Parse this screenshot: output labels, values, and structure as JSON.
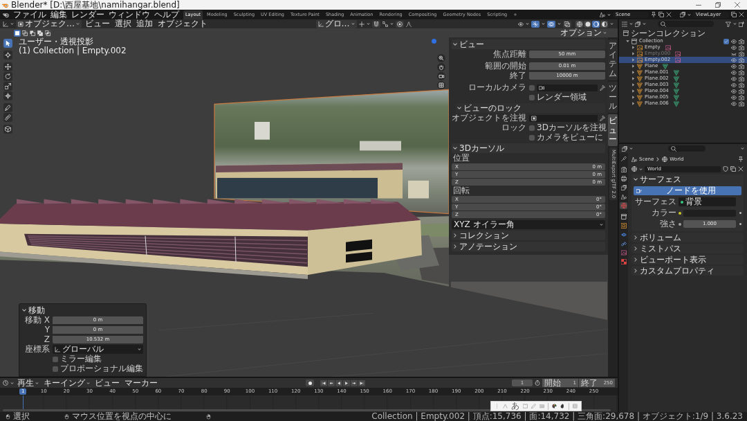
{
  "window": {
    "title": "Blender* [D:\\西屋基地\\namihangar.blend]"
  },
  "top_bar": {
    "menus": [
      "ファイル",
      "編集",
      "レンダー",
      "ウィンドウ",
      "ヘルプ"
    ],
    "workspaces": [
      {
        "label": "Layout",
        "selected": true
      },
      {
        "label": "Modeling",
        "selected": false
      },
      {
        "label": "Sculpting",
        "selected": false
      },
      {
        "label": "UV Editing",
        "selected": false
      },
      {
        "label": "Texture Paint",
        "selected": false
      },
      {
        "label": "Shading",
        "selected": false
      },
      {
        "label": "Animation",
        "selected": false
      },
      {
        "label": "Rendering",
        "selected": false
      },
      {
        "label": "Compositing",
        "selected": false
      },
      {
        "label": "Geometry Nodes",
        "selected": false
      },
      {
        "label": "Scripting",
        "selected": false
      }
    ],
    "add_workspace": "+",
    "scene": "Scene",
    "view_layer": "ViewLayer"
  },
  "viewport": {
    "header": {
      "mode": "オブジェク…",
      "menus": [
        "ビュー",
        "選択",
        "追加",
        "オブジェクト"
      ],
      "orientation": "グロ…",
      "snap": false,
      "proportional": false,
      "gizmos": true,
      "overlays": true,
      "xray": false,
      "shading_modes": [
        {
          "kind": "wireframe",
          "selected": false
        },
        {
          "kind": "solid",
          "selected": false
        },
        {
          "kind": "material",
          "selected": true
        },
        {
          "kind": "rendered",
          "selected": false
        }
      ],
      "select_modes": [
        {
          "kind": "set",
          "selected": true
        },
        {
          "kind": "extend",
          "selected": false
        },
        {
          "kind": "subtract",
          "selected": false
        },
        {
          "kind": "invert",
          "selected": false
        },
        {
          "kind": "intersect",
          "selected": false
        }
      ],
      "options": "オプション"
    },
    "overlay_text": [
      "ユーザー・透視投影",
      "(1) Collection | Empty.002"
    ],
    "tools": [
      {
        "kind": "select",
        "selected": true
      },
      {
        "kind": "cursor",
        "selected": false
      },
      {
        "kind": "move",
        "selected": false
      },
      {
        "kind": "rotate",
        "selected": false
      },
      {
        "kind": "scale",
        "selected": false
      },
      {
        "kind": "transform",
        "selected": false
      },
      {
        "kind": "annotate",
        "selected": false
      },
      {
        "kind": "measure",
        "selected": false
      },
      {
        "kind": "add_cube",
        "selected": false
      }
    ],
    "sidebar": {
      "view": {
        "title": "ビュー",
        "expanded": true,
        "clip": [
          {
            "label": "焦点距離",
            "value": "50 mm"
          },
          {
            "label": "範囲の開始",
            "value": "0.01 m"
          },
          {
            "label": "終了",
            "value": "10000 m"
          }
        ],
        "local_camera": {
          "label": "ローカルカメラ",
          "checked": false
        },
        "render_region": {
          "label": "レンダー領域",
          "checked": false
        },
        "lock": {
          "title": "ビューのロック",
          "expanded": true,
          "lock_object_label": "オブジェクトを注視",
          "lock_label": "ロック",
          "options": [
            {
              "label": "3Dカーソルを注視",
              "checked": false
            },
            {
              "label": "カメラをビューに",
              "checked": false
            }
          ]
        }
      },
      "cursor": {
        "title": "3Dカーソル",
        "expanded": true,
        "location_label": "位置",
        "location": [
          {
            "axis": "X",
            "value": "0 m"
          },
          {
            "axis": "Y",
            "value": "0 m"
          },
          {
            "axis": "Z",
            "value": "0 m"
          }
        ],
        "rotation_label": "回転",
        "rotation": [
          {
            "axis": "X",
            "value": "0°"
          },
          {
            "axis": "Y",
            "value": "0°"
          },
          {
            "axis": "Z",
            "value": "0°"
          }
        ],
        "rotation_mode": "XYZ オイラー角"
      },
      "collapsed": [
        {
          "title": "コレクション",
          "expanded": false
        },
        {
          "title": "アノテーション",
          "expanded": false
        }
      ]
    },
    "sidebar_tabs": [
      {
        "label": "アイテム",
        "kind": "stacked",
        "selected": false
      },
      {
        "label": "ツール",
        "kind": "stacked",
        "selected": false
      },
      {
        "label": "ビュー",
        "kind": "stacked",
        "selected": true
      },
      {
        "label": "MultiExport glTF 2.0",
        "kind": "rotated",
        "selected": false
      }
    ],
    "operator_panel": {
      "title": "移動",
      "expanded": true,
      "fields": [
        {
          "label": "移動 X",
          "value": "0 m"
        },
        {
          "label": "Y",
          "value": "0 m"
        },
        {
          "label": "Z",
          "value": "10.532 m"
        }
      ],
      "orientation_label": "座標系",
      "orientation": "グローバル",
      "options": [
        {
          "label": "ミラー編集",
          "checked": false
        },
        {
          "label": "プロポーショナル編集",
          "checked": false
        }
      ]
    }
  },
  "outliner": {
    "tree": [
      {
        "name": "シーンコレクション",
        "children": [
          {
            "name": "Collection",
            "expanded": true,
            "checked": true,
            "visible": true,
            "children": [
              {
                "name": "Empty",
                "kind": "empty",
                "selected": false,
                "visible": true
              },
              {
                "name": "Empty.000",
                "kind": "empty",
                "selected": false,
                "visible": false
              },
              {
                "name": "Empty.002",
                "kind": "empty",
                "selected": true,
                "visible": true
              },
              {
                "name": "Plane",
                "kind": "mesh",
                "selected": false,
                "visible": true
              },
              {
                "name": "Plane.001",
                "kind": "mesh",
                "selected": false,
                "visible": true
              },
              {
                "name": "Plane.002",
                "kind": "mesh",
                "selected": false,
                "visible": true
              },
              {
                "name": "Plane.003",
                "kind": "mesh",
                "selected": false,
                "visible": true
              },
              {
                "name": "Plane.004",
                "kind": "mesh",
                "selected": false,
                "visible": true
              },
              {
                "name": "Plane.005",
                "kind": "mesh",
                "selected": false,
                "visible": true
              },
              {
                "name": "Plane.006",
                "kind": "mesh",
                "selected": false,
                "visible": true
              }
            ]
          }
        ]
      }
    ]
  },
  "properties": {
    "tabs": [
      {
        "kind": "tool",
        "selected": false
      },
      {
        "kind": "render",
        "selected": false
      },
      {
        "kind": "output",
        "selected": false
      },
      {
        "kind": "view_layer",
        "selected": false
      },
      {
        "kind": "scene",
        "selected": false
      },
      {
        "kind": "world",
        "selected": true
      },
      {
        "kind": "collection",
        "selected": false
      },
      {
        "kind": "object",
        "selected": false
      },
      {
        "kind": "physics",
        "selected": false
      },
      {
        "kind": "constraints",
        "selected": false
      },
      {
        "kind": "data",
        "selected": false
      },
      {
        "kind": "texture",
        "selected": false
      }
    ],
    "breadcrumb": [
      "Scene",
      "World"
    ],
    "world": "World",
    "surface": {
      "title": "サーフェス",
      "expanded": true,
      "use_nodes": "ノードを使用",
      "surface_label": "サーフェス",
      "surface_value": "背景",
      "color_label": "カラー",
      "strength_label": "強さ",
      "strength": "1.000"
    },
    "collapsed": [
      {
        "title": "ボリューム",
        "expanded": false
      },
      {
        "title": "ミストパス",
        "expanded": false
      },
      {
        "title": "ビューポート表示",
        "expanded": false
      },
      {
        "title": "カスタムプロパティ",
        "expanded": false
      }
    ]
  },
  "timeline": {
    "menus": [
      {
        "label": "再生",
        "dropdown": true
      },
      {
        "label": "キーイング",
        "dropdown": true
      },
      {
        "label": "ビュー",
        "dropdown": false
      },
      {
        "label": "マーカー",
        "dropdown": false
      }
    ],
    "auto_keying": false,
    "current_frame": "1",
    "start_label": "開始",
    "start": "1",
    "end_label": "終了",
    "end": "250",
    "playhead": "1",
    "ticks": [
      "10",
      "20",
      "30",
      "40",
      "50",
      "60",
      "70",
      "80",
      "90",
      "100",
      "110",
      "120",
      "130",
      "140",
      "150",
      "160",
      "170",
      "180",
      "190",
      "200",
      "210",
      "220",
      "230",
      "240",
      "250"
    ]
  },
  "ime_toolbar": {
    "mode": "あ"
  },
  "status_bar": {
    "hints": [
      {
        "kind": "left",
        "label": "選択"
      },
      {
        "kind": "middle",
        "label": "マウス位置を視点の中心に"
      },
      {
        "kind": "right"
      }
    ],
    "info": "Collection | Empty.002 | 頂点:15,736 | 面:14,732 | 三角面:29,678 | オブジェクト:1/9 | 3.6.23"
  }
}
